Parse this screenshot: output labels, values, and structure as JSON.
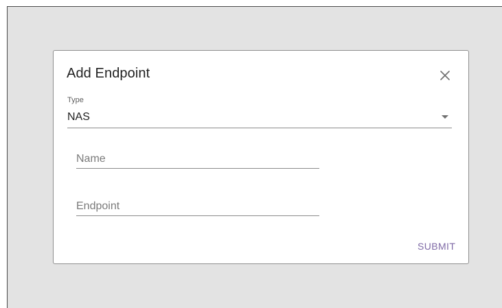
{
  "dialog": {
    "title": "Add Endpoint",
    "close_icon": "close-icon",
    "type_field": {
      "label": "Type",
      "value": "NAS",
      "dropdown_icon": "dropdown-arrow-icon"
    },
    "name_field": {
      "placeholder": "Name",
      "value": ""
    },
    "endpoint_field": {
      "placeholder": "Endpoint",
      "value": ""
    },
    "submit_label": "SUBMIT"
  },
  "colors": {
    "backdrop": "#e3e3e3",
    "dialog_background": "#ffffff",
    "submit_accent": "#7f6aa6"
  }
}
